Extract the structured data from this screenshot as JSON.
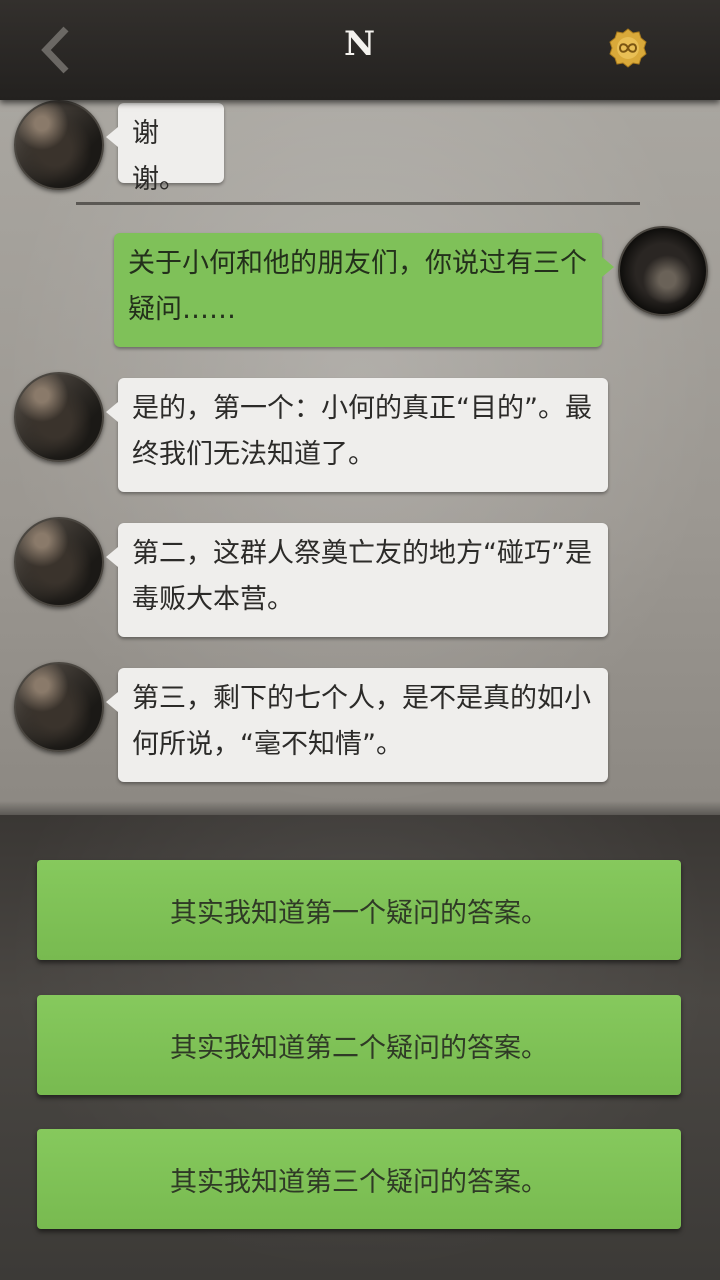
{
  "header": {
    "title": "N",
    "back_icon": "chevron-left-icon",
    "coin_icon": "infinity-coin-icon"
  },
  "messages": [
    {
      "side": "left",
      "text": "谢谢。"
    },
    {
      "side": "right",
      "text": "关于小何和他的朋友们，你说过有三个疑问……"
    },
    {
      "side": "left",
      "text": "是的，第一个：小何的真正“目的”。最终我们无法知道了。"
    },
    {
      "side": "left",
      "text": "第二，这群人祭奠亡友的地方“碰巧”是毒贩大本营。"
    },
    {
      "side": "left",
      "text": "第三，剩下的七个人，是不是真的如小何所说，“毫不知情”。"
    }
  ],
  "options": [
    {
      "label": "其实我知道第一个疑问的答案。"
    },
    {
      "label": "其实我知道第二个疑问的答案。"
    },
    {
      "label": "其实我知道第三个疑问的答案。"
    }
  ],
  "colors": {
    "bubble_left": "#efeeec",
    "bubble_right": "#7fc159",
    "option_green": "#80c257",
    "header_bg": "#2b2927"
  }
}
